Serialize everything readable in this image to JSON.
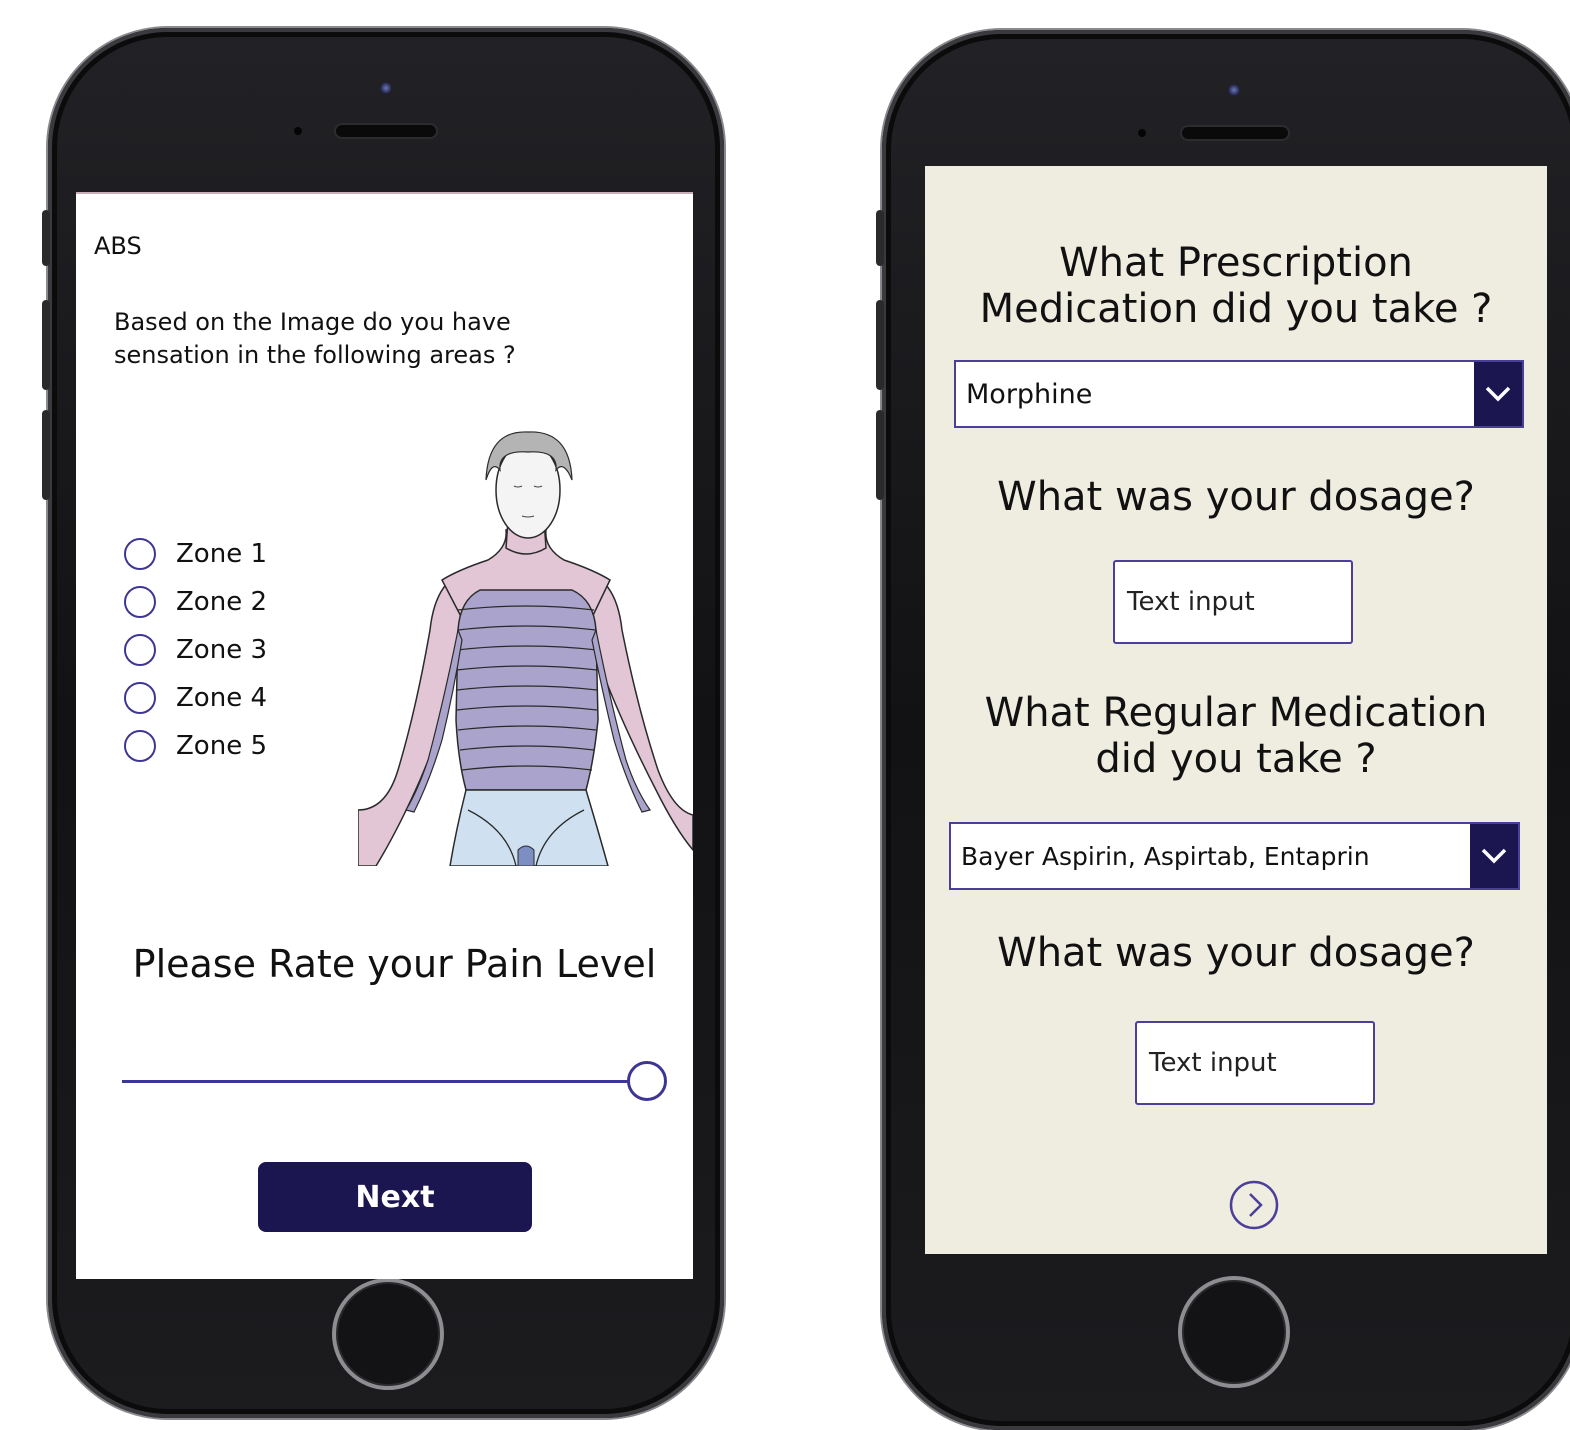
{
  "left_screen": {
    "header": "ABS",
    "question": "Based on the Image do you have sensation in the following areas ?",
    "zones": [
      "Zone 1",
      "Zone 2",
      "Zone 3",
      "Zone 4",
      "Zone 5"
    ],
    "pain_title": "Please Rate your Pain Level",
    "pain_level_fraction": 1.0,
    "next_label": "Next"
  },
  "right_screen": {
    "q_prescription": "What Prescription Medication did you take ?",
    "prescription_selected": "Morphine",
    "q_dosage_1": "What was your dosage?",
    "dosage_1_placeholder": "Text input",
    "q_regular": "What Regular Medication did you take ?",
    "regular_selected": "Bayer Aspirin, Aspirtab, Entaprin",
    "q_dosage_2": "What was your dosage?",
    "dosage_2_placeholder": "Text input"
  },
  "colors": {
    "accent": "#3e3694",
    "button_dark": "#1b1550",
    "right_bg": "#efede0"
  }
}
